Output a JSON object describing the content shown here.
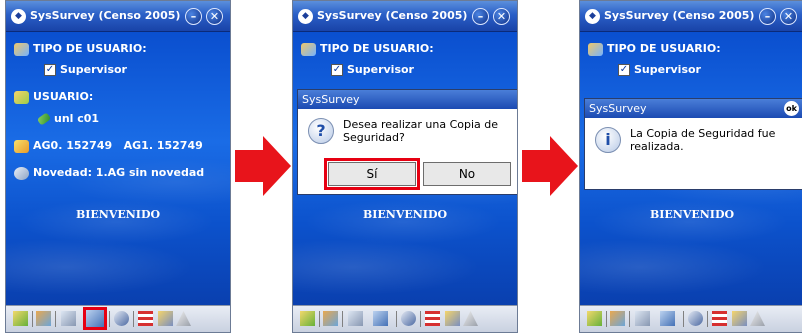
{
  "app": {
    "title": "SysSurvey (Censo 2005)",
    "min_glyph": "–",
    "close_glyph": "✕"
  },
  "form": {
    "tipo_label": "TIPO DE USUARIO:",
    "supervisor_label": "Supervisor",
    "usuario_label": "USUARIO:",
    "usuario_value": "unl c01",
    "ag0": "AG0. 152749",
    "ag1": "AG1. 152749",
    "novedad": "Novedad:  1.AG sin novedad",
    "bienvenido": "BIENVENIDO"
  },
  "confirm_dialog": {
    "title": "SysSurvey",
    "message_line1": "Desea realizar una Copia de",
    "message_line2": "Seguridad?",
    "yes_label": "Sí",
    "no_label": "No",
    "icon": "question-icon",
    "icon_glyph": "?"
  },
  "info_dialog": {
    "title": "SysSurvey",
    "ok_label": "ok",
    "message_line1": "La Copia de Seguridad fue",
    "message_line2": "realizada.",
    "icon": "info-icon",
    "icon_glyph": "i"
  },
  "toolbar_icons": [
    "folder-icon",
    "users-icon",
    "copy-icon",
    "save-icon",
    "refresh-icon",
    "flag-icon",
    "edit-icon",
    "up-icon"
  ],
  "colors": {
    "accent_red": "#e60012",
    "arrow_red": "#e8141b",
    "background_blue": "#1a6ce6"
  }
}
